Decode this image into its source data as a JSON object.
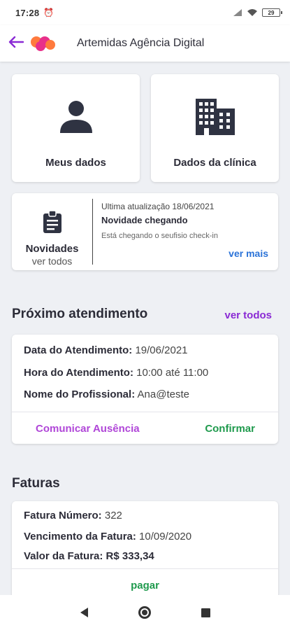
{
  "status_bar": {
    "time": "17:28",
    "battery": "29"
  },
  "app_bar": {
    "title": "Artemidas Agência Digital"
  },
  "tiles": [
    {
      "label": "Meus dados",
      "icon": "person-icon"
    },
    {
      "label": "Dados da clínica",
      "icon": "building-icon"
    }
  ],
  "news": {
    "title": "Novidades",
    "see_all": "ver todos",
    "last_update": "Ultima atualização 18/06/2021",
    "headline": "Novidade chegando",
    "description": "Está chegando o seufisio check-in",
    "more": "ver mais"
  },
  "appointment": {
    "section_title": "Próximo atendimento",
    "see_all": "ver todos",
    "rows": [
      {
        "label": "Data do Atendimento:",
        "value": "19/06/2021"
      },
      {
        "label": "Hora do Atendimento:",
        "value": "10:00 até 11:00"
      },
      {
        "label": "Nome do Profissional:",
        "value": "Ana@teste"
      }
    ],
    "absence_label": "Comunicar Ausência",
    "confirm_label": "Confirmar"
  },
  "invoices": {
    "section_title": "Faturas",
    "rows": [
      {
        "label": "Fatura Número:",
        "value": "322"
      },
      {
        "label": "Vencimento da Fatura:",
        "value": "10/09/2020"
      },
      {
        "label": "Valor da Fatura:",
        "value": "R$ 333,34"
      }
    ],
    "pay_label": "pagar"
  },
  "colors": {
    "accent_purple": "#8a2ad4",
    "link_blue": "#2b73d8",
    "confirm_green": "#1f9a4d",
    "absence_purple": "#b046d8",
    "logo_orange": "#ff7a3d",
    "logo_pink": "#e8308a"
  }
}
